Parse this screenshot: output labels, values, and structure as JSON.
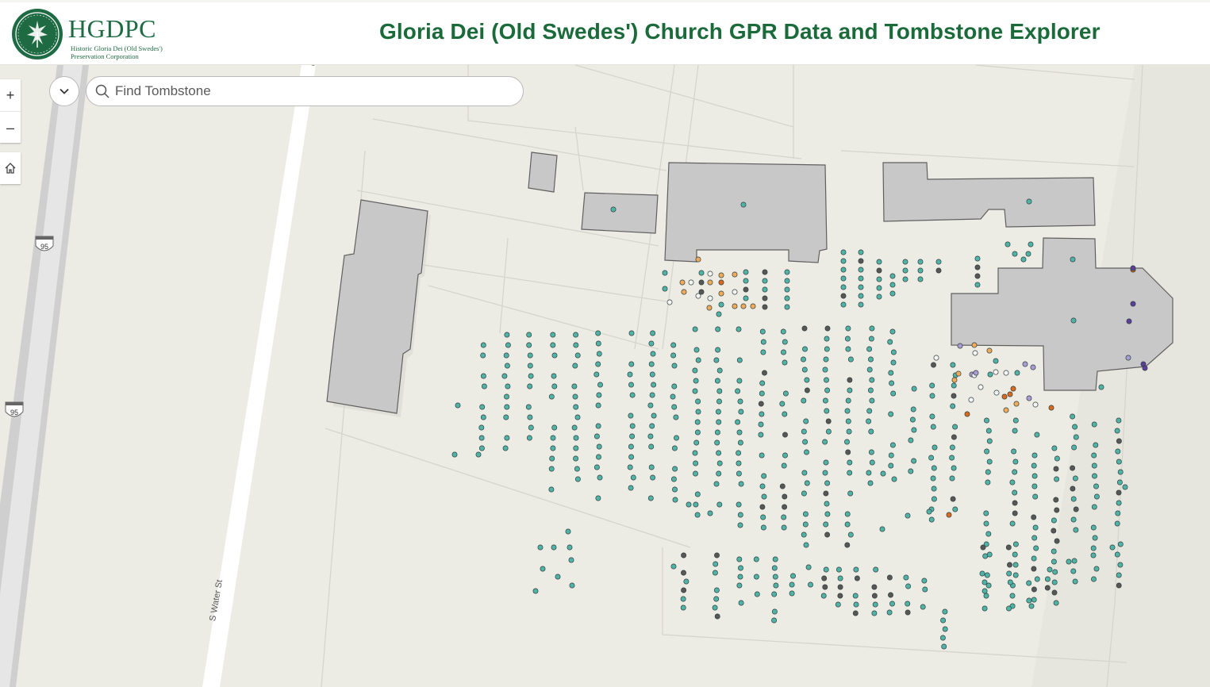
{
  "header": {
    "logo_abbr": "HGDPC",
    "logo_sub_line1": "Historic Gloria Dei (Old Swedes')",
    "logo_sub_line2": "Preservation Corporation",
    "title": "Gloria Dei (Old Swedes') Church GPR Data and Tombstone Explorer"
  },
  "search": {
    "placeholder": "Find Tombstone",
    "value": ""
  },
  "controls": {
    "zoom_in": "+",
    "zoom_out": "–"
  },
  "map": {
    "street_label": "S Water St",
    "street_label_partial": "er",
    "highway_shield": "95",
    "colors": {
      "land": "#ecebe4",
      "building": "#c8c8c8",
      "building_stroke": "#606060",
      "teal": "#4fb3a8",
      "dark": "#575757",
      "white": "#f4f4f4",
      "light_orange": "#f0aa5a",
      "dark_orange": "#d9691e",
      "light_purple": "#a99bd3",
      "dark_purple": "#5c3f9a",
      "title_green": "#1b6b3a"
    }
  }
}
